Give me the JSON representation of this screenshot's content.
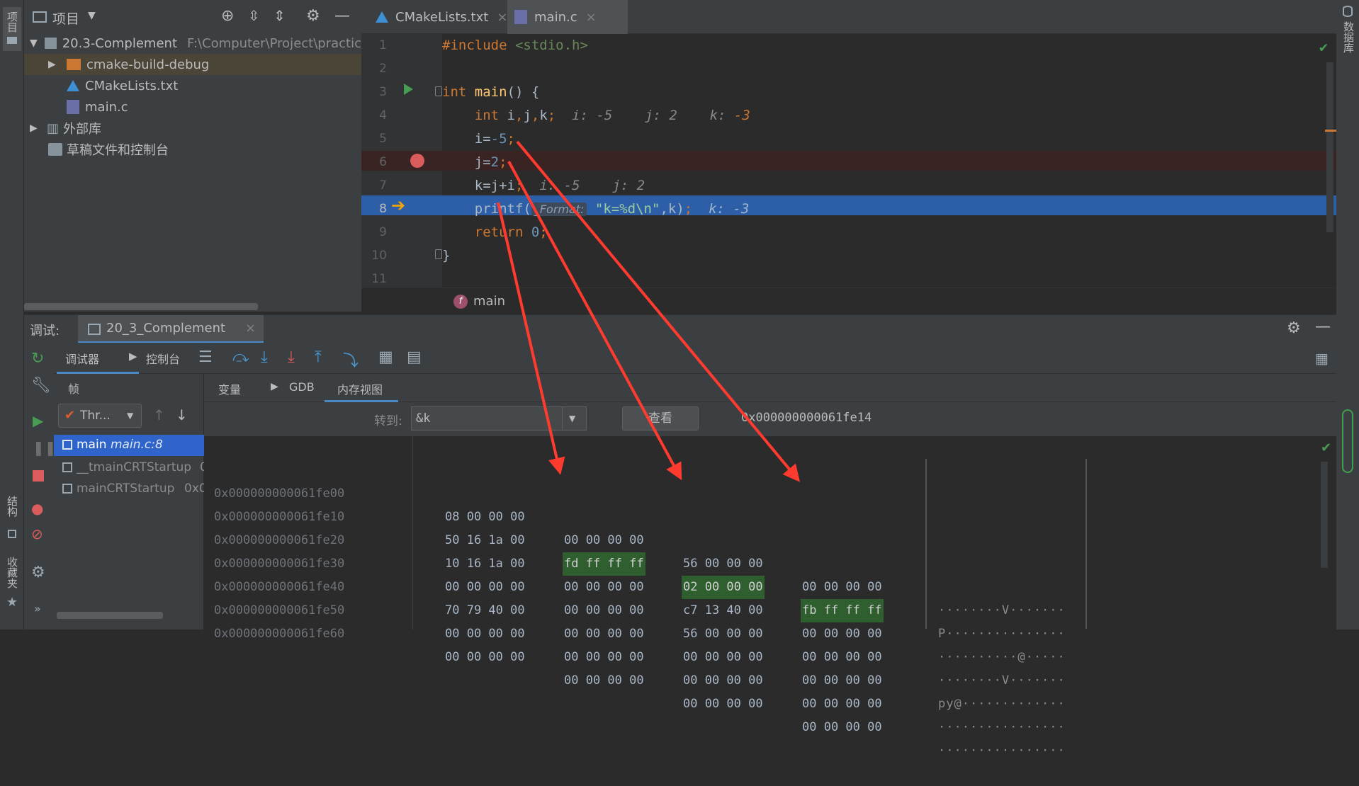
{
  "left_strip": {
    "project_tab": "项目",
    "structure_tab": "结构",
    "favorites_tab": "收藏夹"
  },
  "right_strip": {
    "database_tab": "数据库"
  },
  "project": {
    "header": "项目",
    "tree": [
      {
        "label": "20.3-Complement",
        "path": "F:\\Computer\\Project\\practic"
      },
      {
        "label": "cmake-build-debug"
      },
      {
        "label": "CMakeLists.txt"
      },
      {
        "label": "main.c"
      },
      {
        "label": "外部库"
      },
      {
        "label": "草稿文件和控制台"
      }
    ]
  },
  "editor": {
    "tabs": [
      {
        "label": "CMakeLists.txt"
      },
      {
        "label": "main.c"
      }
    ],
    "line_numbers": [
      "1",
      "2",
      "3",
      "4",
      "5",
      "6",
      "7",
      "8",
      "9",
      "10",
      "11"
    ],
    "breadcrumb": "main",
    "breadcrumb_badge": "f",
    "param_hint": "_Format:"
  },
  "debug": {
    "label": "调试:",
    "session": "20_3_Complement",
    "tabs": {
      "debugger": "调试器",
      "console": "控制台"
    },
    "frames_label": "帧",
    "thread": "Thr...",
    "frames": [
      {
        "name": "main",
        "loc": "main.c:8"
      },
      {
        "name": "__tmainCRTStartup",
        "loc": "0"
      },
      {
        "name": "mainCRTStartup",
        "loc": "0x0"
      }
    ],
    "subtabs": {
      "variables": "变量",
      "gdb": "GDB",
      "memory": "内存视图"
    },
    "goto_label": "转到:",
    "goto_value": "&k",
    "view_button": "查看",
    "current_address": "0x000000000061fe14"
  },
  "memory": {
    "rows": [
      {
        "addr": "0x000000000061fe00",
        "g": [
          "08 00 00 00",
          "00 00 00 00",
          "56 00 00 00",
          "00 00 00 00"
        ],
        "ascii": "········V·······"
      },
      {
        "addr": "0x000000000061fe10",
        "g": [
          "50 16 1a 00",
          "fd ff ff ff",
          "02 00 00 00",
          "fb ff ff ff"
        ],
        "ascii": "P···············"
      },
      {
        "addr": "0x000000000061fe20",
        "g": [
          "10 16 1a 00",
          "00 00 00 00",
          "c7 13 40 00",
          "00 00 00 00"
        ],
        "ascii": "··········@·····"
      },
      {
        "addr": "0x000000000061fe30",
        "g": [
          "00 00 00 00",
          "00 00 00 00",
          "56 00 00 00",
          "00 00 00 00"
        ],
        "ascii": "········V·······"
      },
      {
        "addr": "0x000000000061fe40",
        "g": [
          "70 79 40 00",
          "00 00 00 00",
          "00 00 00 00",
          "00 00 00 00"
        ],
        "ascii": "py@·············"
      },
      {
        "addr": "0x000000000061fe50",
        "g": [
          "00 00 00 00",
          "00 00 00 00",
          "00 00 00 00",
          "00 00 00 00"
        ],
        "ascii": "················"
      },
      {
        "addr": "0x000000000061fe60",
        "g": [
          "00 00 00 00",
          "00 00 00 00",
          "00 00 00 00",
          "00 00 00 00"
        ],
        "ascii": "················"
      }
    ]
  },
  "colors": {
    "breakpoint_line": "#3a2323",
    "current_line": "#2d5fa8",
    "memory_highlight": "#2f5f2f",
    "arrow": "#ff3b30",
    "execution_arrow": "#f0a30a"
  }
}
